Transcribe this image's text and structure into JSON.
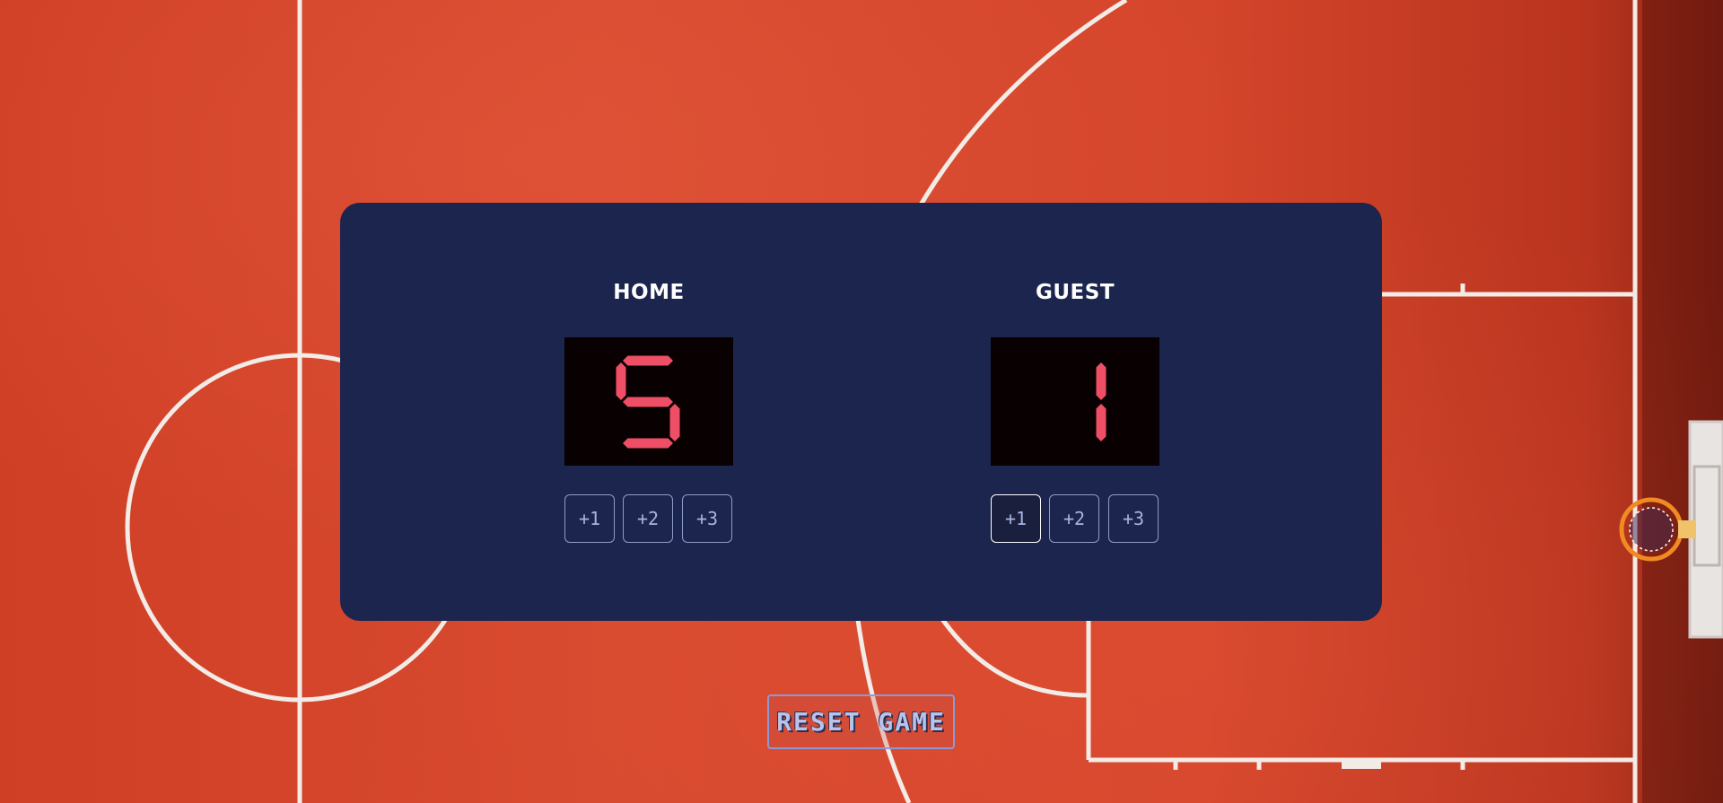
{
  "background": {
    "description_icon": "basketball-court",
    "court_color": "#d4452a",
    "line_color": "#f3ebe6"
  },
  "scoreboard": {
    "panel_color": "#1c254d",
    "digit_color": "#ef4f66",
    "home": {
      "label": "HOME",
      "score": "5",
      "buttons": [
        "+1",
        "+2",
        "+3"
      ]
    },
    "guest": {
      "label": "GUEST",
      "score": "1",
      "buttons": [
        "+1",
        "+2",
        "+3"
      ]
    }
  },
  "reset": {
    "label": "RESET GAME"
  }
}
